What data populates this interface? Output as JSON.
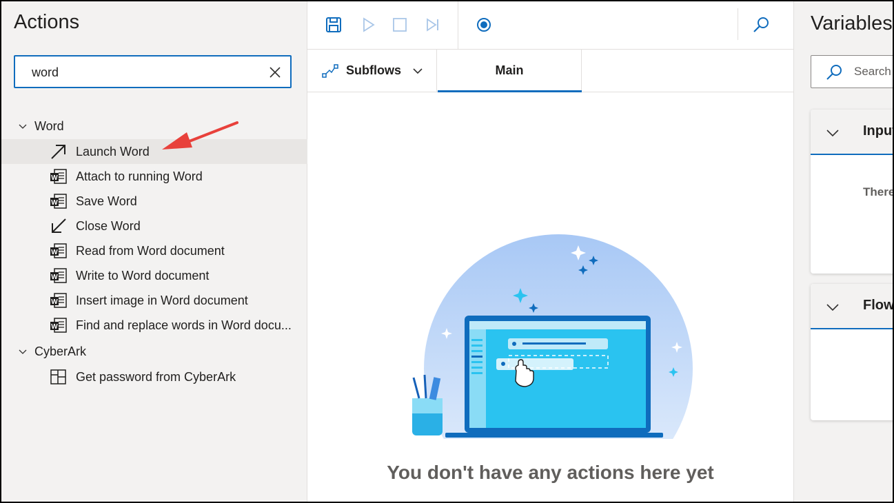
{
  "actions_pane": {
    "title": "Actions",
    "search": {
      "value": "word",
      "placeholder": ""
    },
    "groups": [
      {
        "label": "Word",
        "items": [
          {
            "label": "Launch Word",
            "icon": "launch-arrow-icon"
          },
          {
            "label": "Attach to running Word",
            "icon": "word-document-icon"
          },
          {
            "label": "Save Word",
            "icon": "word-document-icon"
          },
          {
            "label": "Close Word",
            "icon": "close-arrow-icon"
          },
          {
            "label": "Read from Word document",
            "icon": "word-document-icon"
          },
          {
            "label": "Write to Word document",
            "icon": "word-document-icon"
          },
          {
            "label": "Insert image in Word document",
            "icon": "word-document-icon"
          },
          {
            "label": "Find and replace words in Word docu...",
            "icon": "word-document-icon"
          }
        ]
      },
      {
        "label": "CyberArk",
        "items": [
          {
            "label": "Get password from CyberArk",
            "icon": "cyberark-icon"
          }
        ]
      }
    ]
  },
  "designer": {
    "toolbar": [
      "save-icon",
      "run-icon",
      "stop-icon",
      "next-step-icon",
      "record-icon",
      "search-icon"
    ],
    "subflows_label": "Subflows",
    "main_tab_label": "Main",
    "empty_message": "You don't have any actions here yet"
  },
  "variables_pane": {
    "title": "Variables",
    "search_placeholder": "Search v",
    "sections": [
      {
        "title": "Input",
        "body": "There"
      },
      {
        "title": "Flow",
        "body": ""
      }
    ]
  },
  "colors": {
    "accent": "#0f6cbd",
    "annotation_arrow": "#e8413b",
    "pane_bg": "#f3f2f1"
  }
}
